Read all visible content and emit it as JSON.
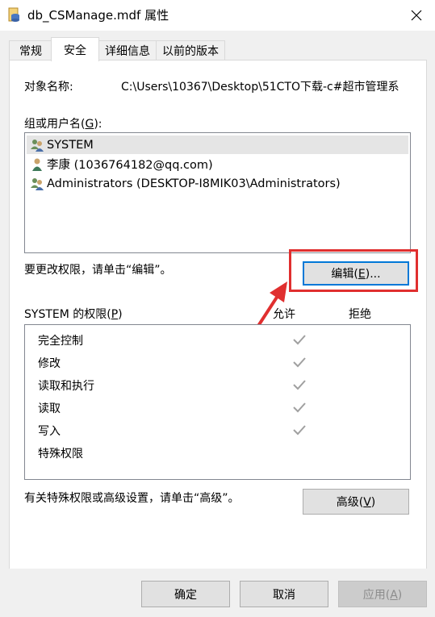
{
  "window": {
    "title": "db_CSManage.mdf 属性",
    "icon": "database-file-icon",
    "close_glyph": "✕"
  },
  "tabs": [
    {
      "label": "常规",
      "active": false
    },
    {
      "label": "安全",
      "active": true
    },
    {
      "label": "详细信息",
      "active": false
    },
    {
      "label": "以前的版本",
      "active": false
    }
  ],
  "security": {
    "object_name_label": "对象名称:",
    "object_name_value": "C:\\Users\\10367\\Desktop\\51CTO下载-c#超市管理系",
    "group_label": "组或用户名(G):",
    "users": [
      {
        "name": "SYSTEM",
        "icon": "group-users-icon",
        "selected": true
      },
      {
        "name": "李康 (1036764182@qq.com)",
        "icon": "user-icon",
        "selected": false
      },
      {
        "name": "Administrators (DESKTOP-I8MIK03\\Administrators)",
        "icon": "group-users-icon",
        "selected": false
      }
    ],
    "change_hint": "要更改权限，请单击“编辑”。",
    "edit_button": "编辑(E)...",
    "perm_label": "SYSTEM 的权限(P)",
    "allow_header": "允许",
    "deny_header": "拒绝",
    "permissions": [
      {
        "name": "完全控制",
        "allow": true,
        "deny": false
      },
      {
        "name": "修改",
        "allow": true,
        "deny": false
      },
      {
        "name": "读取和执行",
        "allow": true,
        "deny": false
      },
      {
        "name": "读取",
        "allow": true,
        "deny": false
      },
      {
        "name": "写入",
        "allow": true,
        "deny": false
      },
      {
        "name": "特殊权限",
        "allow": false,
        "deny": false
      }
    ],
    "advanced_hint": "有关特殊权限或高级设置，请单击“高级”。",
    "advanced_button": "高级(V)"
  },
  "footer": {
    "ok": "确定",
    "cancel": "取消",
    "apply": "应用(A)"
  },
  "colors": {
    "annotation": "#e02f2f",
    "check": "#a0a0a0"
  }
}
